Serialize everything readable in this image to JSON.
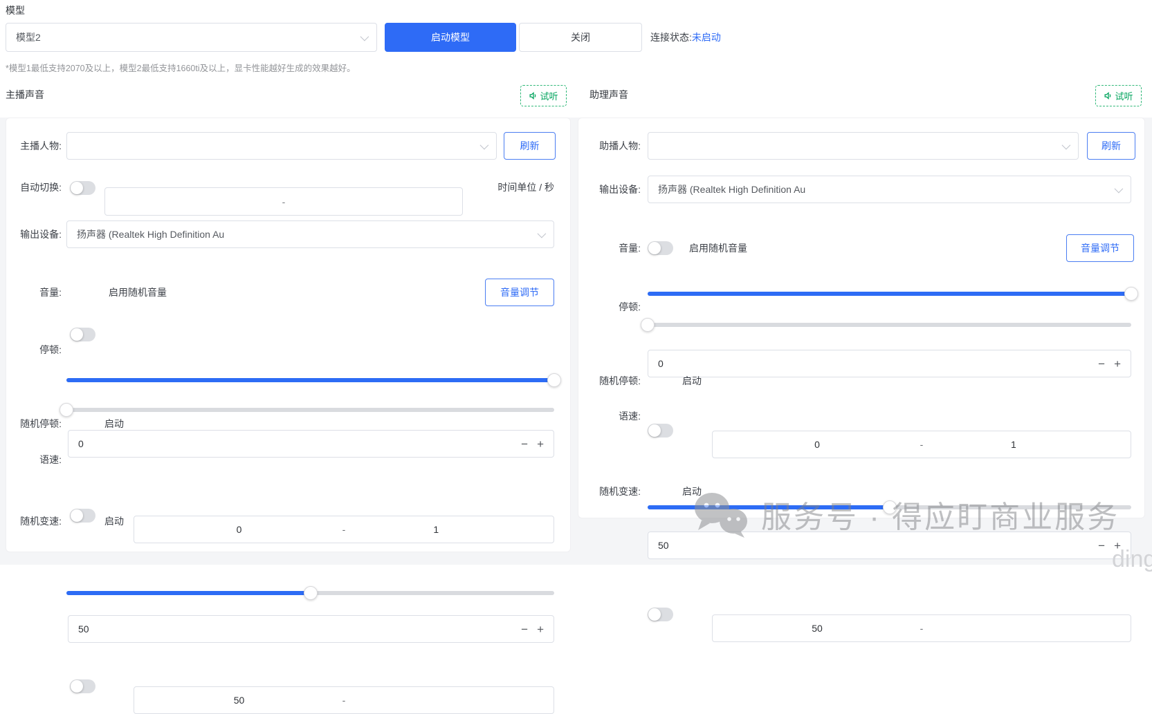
{
  "colors": {
    "accent": "#2e6bf6",
    "green": "#00a35c",
    "slider_track": "#d9dbdf",
    "watermark_gray": "#9a9a9a"
  },
  "icons": {
    "listen": "speaker-icon",
    "select": "chevron-down-icon",
    "watermark": "wechat-icon",
    "decrease": "minus",
    "increase": "plus"
  },
  "ui": {
    "minus": "−",
    "plus": "+"
  },
  "model": {
    "title": "模型",
    "selected": "模型2",
    "start": "启动模型",
    "close": "关闭",
    "status_label": "连接状态:",
    "status_value": "未启动",
    "note": "*模型1最低支持2070及以上，模型2最低支持1660ti及以上，显卡性能越好生成的效果越好。"
  },
  "host": {
    "title": "主播声音",
    "listen": "试听",
    "person_label": "主播人物:",
    "person_value": "",
    "refresh": "刷新",
    "auto_switch_label": "自动切换:",
    "auto_switch_value": "-",
    "time_unit": "时间单位 / 秒",
    "device_label": "输出设备:",
    "device_value": "扬声器 (Realtek High Definition Au",
    "volume_label": "音量:",
    "random_volume": "启用随机音量",
    "volume_btn": "音量调节",
    "volume_percent": 100,
    "pause_label": "停顿:",
    "pause_percent": 0,
    "pause_value": "0",
    "random_pause_label": "随机停顿:",
    "enable": "启动",
    "random_pause_min": "0",
    "dash": "-",
    "random_pause_max": "1",
    "speed_label": "语速:",
    "speed_percent": 50,
    "speed_value": "50",
    "random_speed_label": "随机变速:",
    "random_speed_min": "50"
  },
  "assistant": {
    "title": "助理声音",
    "listen": "试听",
    "person_label": "助播人物:",
    "person_value": "",
    "refresh": "刷新",
    "device_label": "输出设备:",
    "device_value": "扬声器 (Realtek High Definition Au",
    "volume_label": "音量:",
    "random_volume": "启用随机音量",
    "volume_btn": "音量调节",
    "volume_percent": 100,
    "pause_label": "停顿:",
    "pause_percent": 0,
    "pause_value": "0",
    "random_pause_label": "随机停顿:",
    "enable": "启动",
    "random_pause_min": "0",
    "dash": "-",
    "random_pause_max": "1",
    "speed_label": "语速:",
    "speed_percent": 50,
    "speed_value": "50",
    "random_speed_label": "随机变速:",
    "random_speed_min": "50"
  },
  "watermark": {
    "text": "服务号 · 得应盯商业服务",
    "corner": "ding"
  }
}
